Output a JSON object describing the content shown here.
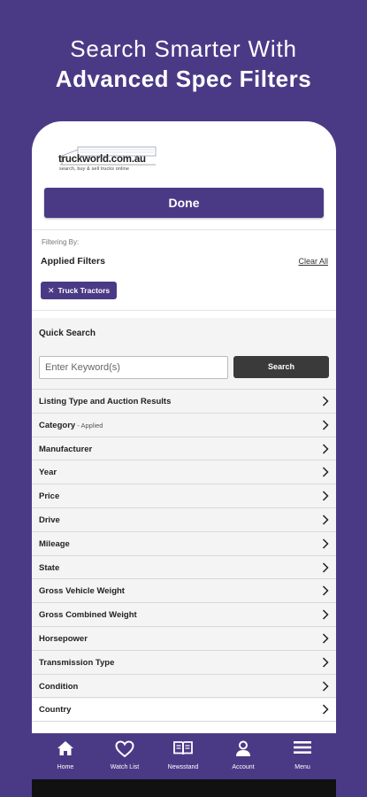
{
  "promo": {
    "line1": "Search Smarter With",
    "line2": "Advanced Spec Filters"
  },
  "logo": {
    "name": "truckworld.com.au",
    "tagline": "search, buy & sell trucks online"
  },
  "done_label": "Done",
  "filters_header": {
    "filtering_by": "Filtering By:",
    "applied_title": "Applied Filters",
    "clear_all": "Clear All",
    "chip_x": "✕",
    "chip_label": "Truck Tractors"
  },
  "quick_search": {
    "title": "Quick Search",
    "placeholder": "Enter Keyword(s)",
    "search_label": "Search"
  },
  "filter_rows": [
    {
      "label": "Listing Type and Auction Results",
      "suffix": ""
    },
    {
      "label": "Category",
      "suffix": " - Applied"
    },
    {
      "label": "Manufacturer",
      "suffix": ""
    },
    {
      "label": "Year",
      "suffix": ""
    },
    {
      "label": "Price",
      "suffix": ""
    },
    {
      "label": "Drive",
      "suffix": ""
    },
    {
      "label": "Mileage",
      "suffix": ""
    },
    {
      "label": "State",
      "suffix": ""
    },
    {
      "label": "Gross Vehicle Weight",
      "suffix": ""
    },
    {
      "label": "Gross Combined Weight",
      "suffix": ""
    },
    {
      "label": "Horsepower",
      "suffix": ""
    },
    {
      "label": "Transmission Type",
      "suffix": ""
    },
    {
      "label": "Condition",
      "suffix": ""
    },
    {
      "label": "Country",
      "suffix": ""
    }
  ],
  "nav": [
    {
      "label": "Home",
      "icon": "home-icon"
    },
    {
      "label": "Watch List",
      "icon": "heart-icon"
    },
    {
      "label": "Newsstand",
      "icon": "book-icon"
    },
    {
      "label": "Account",
      "icon": "person-icon"
    },
    {
      "label": "Menu",
      "icon": "hamburger-icon"
    }
  ],
  "colors": {
    "brand": "#4a3a86",
    "search_button": "#3a3a3a",
    "section_bg": "#f4f4f4"
  }
}
